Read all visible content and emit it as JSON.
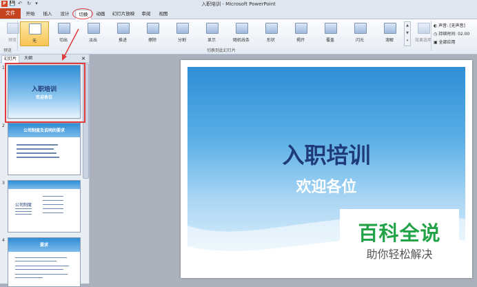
{
  "window": {
    "title": "入职培训 - Microsoft PowerPoint"
  },
  "quick_access": {
    "save": "💾",
    "undo": "↶",
    "redo": "↻",
    "custom": "▾"
  },
  "tabs": [
    "文件",
    "开始",
    "插入",
    "设计",
    "切换",
    "动画",
    "幻灯片放映",
    "审阅",
    "视图"
  ],
  "active_tab": "切换",
  "ribbon": {
    "preview_group": {
      "button": "预览",
      "group_label": "预览"
    },
    "transitions": [
      "无",
      "切出",
      "淡出",
      "推进",
      "擦除",
      "分割",
      "显示",
      "随机线条",
      "形状",
      "揭开",
      "覆盖",
      "闪光",
      "溶解"
    ],
    "selected_transition": "无",
    "group_label": "切换到此幻灯片",
    "effect_options": "效果选项",
    "timing": {
      "sound_label": "声音:",
      "sound_value": "[无声音]",
      "duration_label": "持续时间:",
      "duration_value": "02.00",
      "apply_all": "全部应用"
    }
  },
  "left_panel": {
    "tabs": [
      "幻灯片",
      "大纲"
    ],
    "close": "×",
    "slides": [
      {
        "number": "1",
        "title": "入职培训",
        "subtitle": "欢迎各位"
      },
      {
        "number": "2",
        "title": "公司制度及说明的要求"
      },
      {
        "number": "3",
        "title": "公司制度"
      },
      {
        "number": "4",
        "title": "要求"
      }
    ]
  },
  "slide": {
    "title": "入职培训",
    "subtitle": "欢迎各位"
  },
  "watermark": {
    "title": "百科全说",
    "subtitle": "助你轻松解决"
  },
  "colors": {
    "file_tab": "#c5441f",
    "accent_red": "#e23b3b",
    "slide_title": "#1e3a78",
    "watermark_green": "#23a347"
  }
}
